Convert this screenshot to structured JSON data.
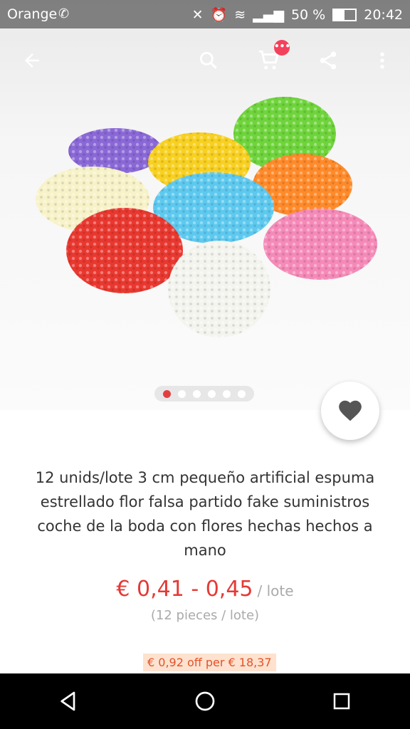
{
  "status_bar": {
    "carrier": "Orange",
    "battery": "50 %",
    "time": "20:42"
  },
  "toolbar": {
    "back_icon": "arrow-back-icon",
    "search_icon": "search-icon",
    "cart_icon": "cart-icon",
    "cart_badge": "•••",
    "share_icon": "share-icon",
    "more_icon": "more-vert-icon"
  },
  "carousel": {
    "image_count": 6,
    "active_index": 0
  },
  "product": {
    "title": "12 unids/lote 3 cm pequeño artificial espuma estrellado flor falsa partido fake suministros coche de la boda con flores hechas hechos a mano",
    "price": "€ 0,41 - 0,45",
    "price_unit": "/ lote",
    "pieces": "(12 pieces / lote)",
    "promo": "€ 0,92 off per € 18,37"
  },
  "colors": {
    "price": "#e53935",
    "promo_bg": "#fde2cf",
    "promo_text": "#e3532a",
    "active_dot": "#e24040"
  }
}
